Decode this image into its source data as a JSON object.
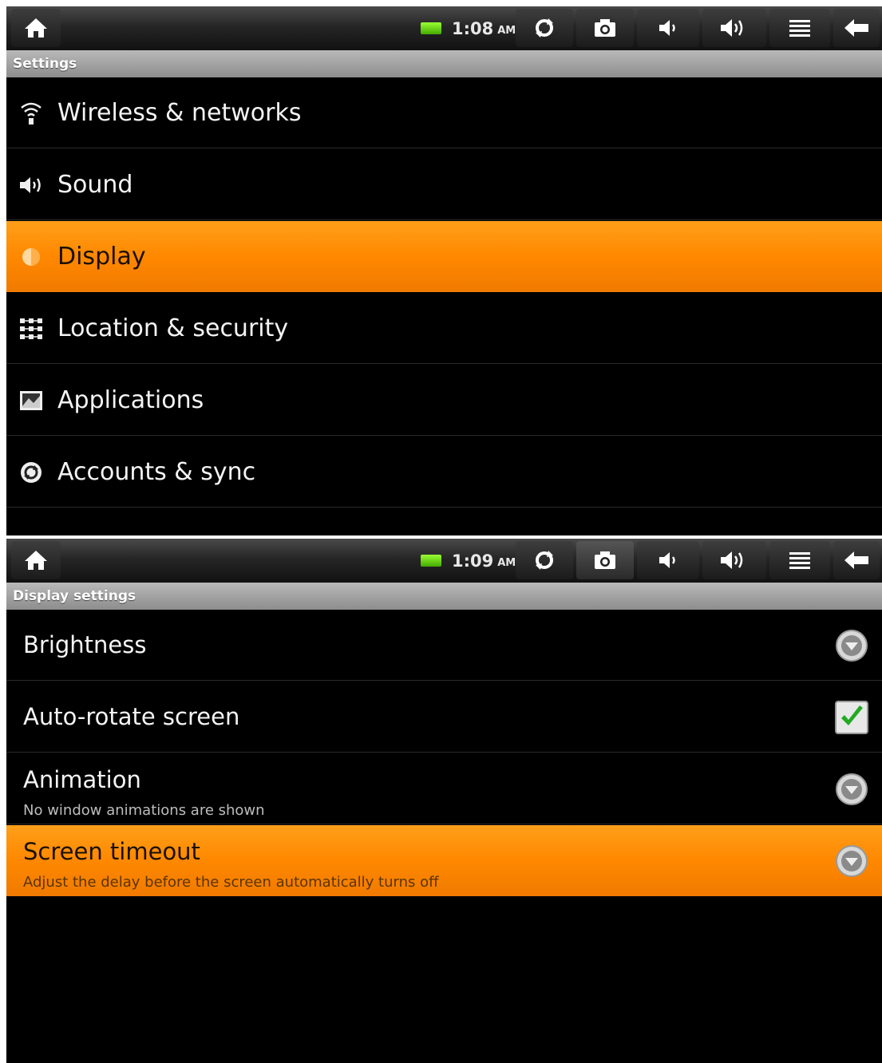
{
  "screen1": {
    "status_bar": {
      "time": "1:08",
      "ampm": "AM"
    },
    "title": "Settings",
    "items": [
      {
        "label": "Wireless & networks",
        "icon": "wifi-icon",
        "selected": false
      },
      {
        "label": "Sound",
        "icon": "speaker-icon",
        "selected": false
      },
      {
        "label": "Display",
        "icon": "display-icon",
        "selected": true
      },
      {
        "label": "Location & security",
        "icon": "location-grid-icon",
        "selected": false
      },
      {
        "label": "Applications",
        "icon": "applications-icon",
        "selected": false
      },
      {
        "label": "Accounts & sync",
        "icon": "sync-icon",
        "selected": false
      }
    ]
  },
  "screen2": {
    "status_bar": {
      "time": "1:09",
      "ampm": "AM"
    },
    "title": "Display settings",
    "items": [
      {
        "title": "Brightness",
        "summary": "",
        "control": "dropdown-icon"
      },
      {
        "title": "Auto-rotate screen",
        "summary": "",
        "control": "checkbox",
        "checked": true
      },
      {
        "title": "Animation",
        "summary": "No window animations are shown",
        "control": "dropdown-icon"
      },
      {
        "title": "Screen timeout",
        "summary": "Adjust the delay before the screen automatically turns off",
        "control": "dropdown-icon",
        "selected": true
      }
    ]
  },
  "colors": {
    "accent": "#ff8c00",
    "background": "#000000",
    "battery": "#66cc22",
    "check": "#22aa22"
  },
  "status_icons": [
    "home-icon",
    "refresh-icon",
    "camera-icon",
    "volume-down-icon",
    "volume-up-icon",
    "menu-icon",
    "back-icon"
  ]
}
